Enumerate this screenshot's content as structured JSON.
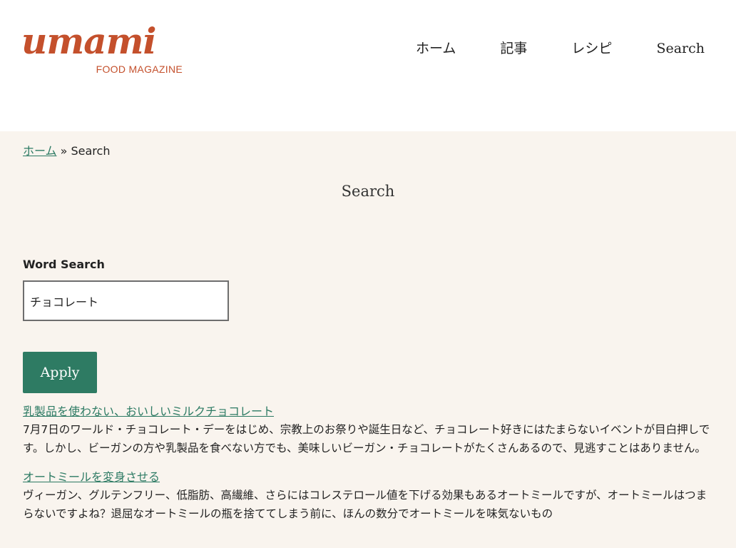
{
  "header": {
    "logo_word": "umami",
    "logo_sub": "FOOD MAGAZINE",
    "nav": [
      {
        "label": "ホーム"
      },
      {
        "label": "記事"
      },
      {
        "label": "レシピ"
      },
      {
        "label": "Search"
      }
    ]
  },
  "breadcrumb": {
    "home": "ホーム",
    "separator": " » ",
    "current": "Search"
  },
  "page": {
    "title": "Search"
  },
  "search": {
    "label": "Word Search",
    "value": "チョコレート",
    "apply_label": "Apply"
  },
  "results": [
    {
      "title": "乳製品を使わない、おいしいミルクチョコレート",
      "excerpt": "7月7日のワールド・チョコレート・デーをはじめ、宗教上のお祭りや誕生日など、チョコレート好きにはたまらないイベントが目白押しです。しかし、ビーガンの方や乳製品を食べない方でも、美味しいビーガン・チョコレートがたくさんあるので、見逃すことはありません。"
    },
    {
      "title": "オートミールを変身させる",
      "excerpt": "ヴィーガン、グルテンフリー、低脂肪、高繊維、さらにはコレステロール値を下げる効果もあるオートミールですが、オートミールはつまらないですよね？退屈なオートミールの瓶を捨ててしまう前に、ほんの数分でオートミールを味気ないもの"
    }
  ],
  "colors": {
    "brand": "#c4502c",
    "accent": "#2e7b63",
    "link": "#2c7a63",
    "main_background": "#f9f4ee"
  }
}
